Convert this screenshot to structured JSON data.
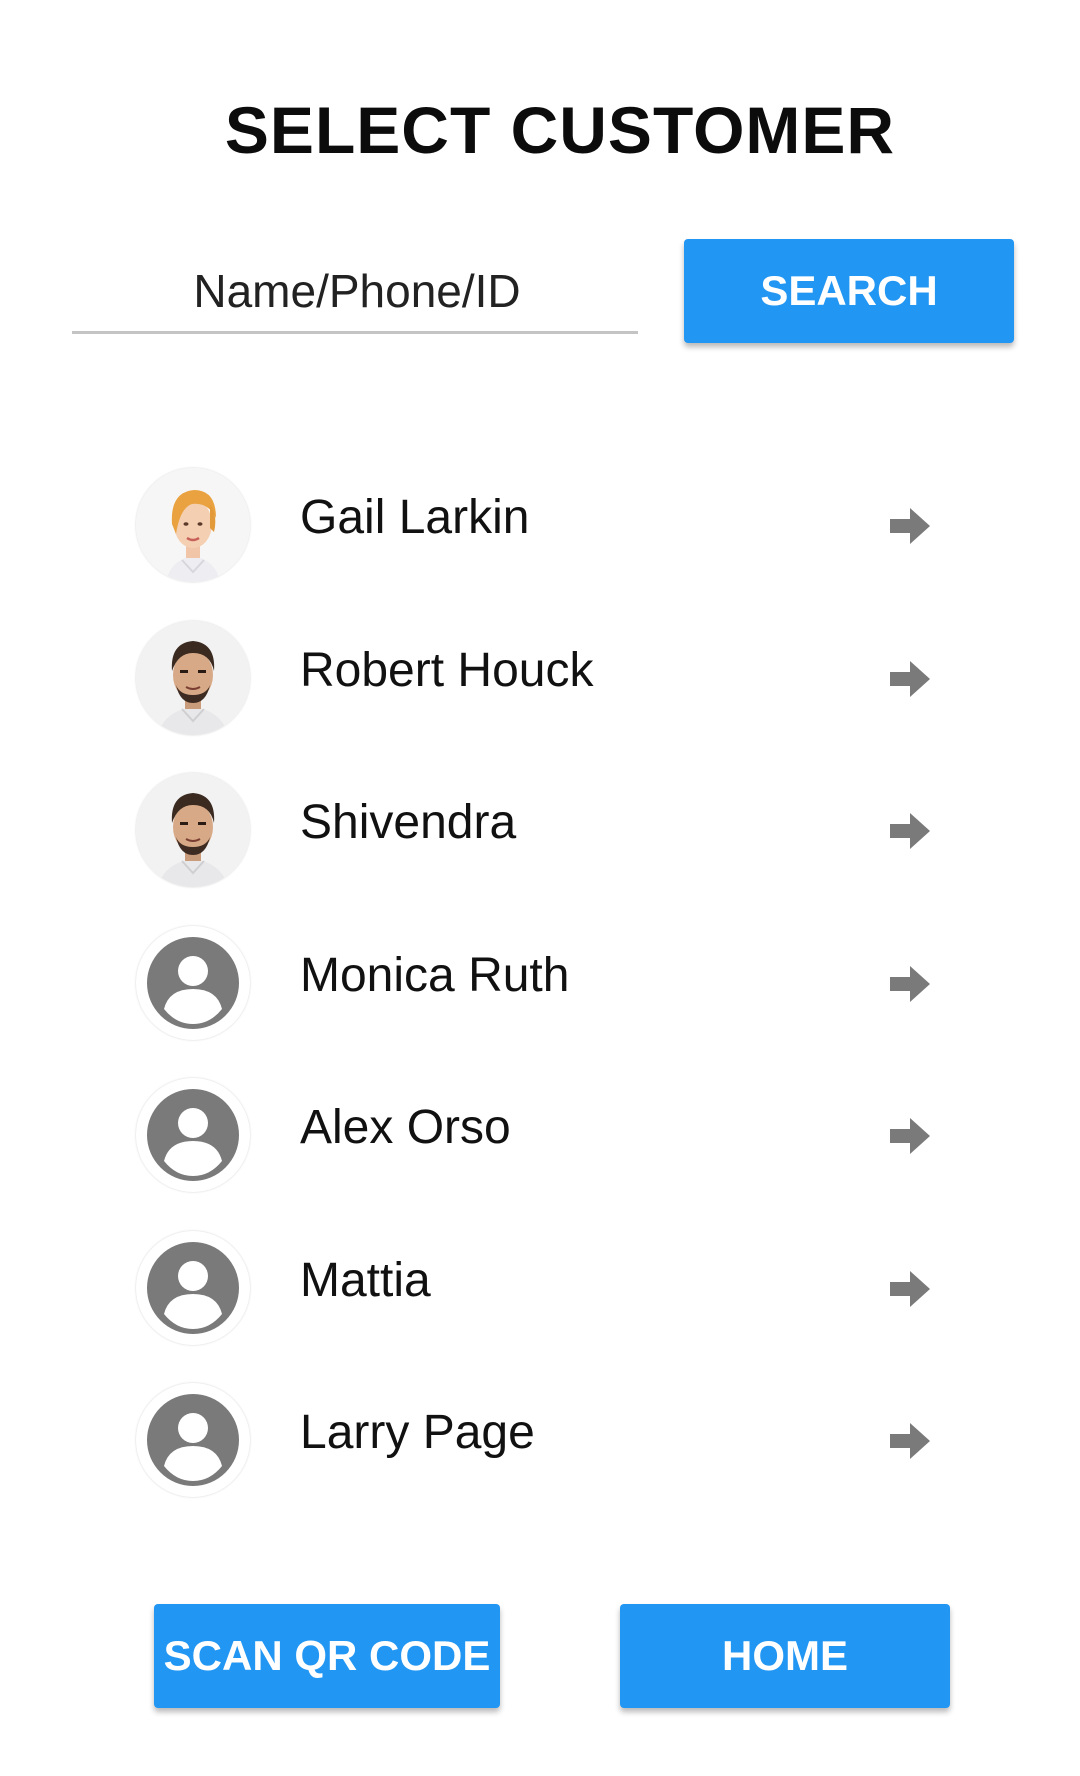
{
  "header": {
    "title": "SELECT CUSTOMER"
  },
  "search": {
    "placeholder": "Name/Phone/ID",
    "value": "",
    "button_label": "SEARCH"
  },
  "customers": [
    {
      "name": "Gail Larkin",
      "avatar": "female-photo"
    },
    {
      "name": "Robert Houck",
      "avatar": "male-photo"
    },
    {
      "name": "Shivendra",
      "avatar": "male-photo"
    },
    {
      "name": "Monica Ruth",
      "avatar": "default-account-icon"
    },
    {
      "name": "Alex Orso",
      "avatar": "default-account-icon"
    },
    {
      "name": "Mattia",
      "avatar": "default-account-icon"
    },
    {
      "name": "Larry Page",
      "avatar": "default-account-icon"
    }
  ],
  "row_action_icon": "arrow-right-icon",
  "footer": {
    "scan_label": "SCAN QR CODE",
    "home_label": "HOME"
  },
  "colors": {
    "accent": "#2196f3",
    "icon_gray": "#7a7a7a"
  }
}
